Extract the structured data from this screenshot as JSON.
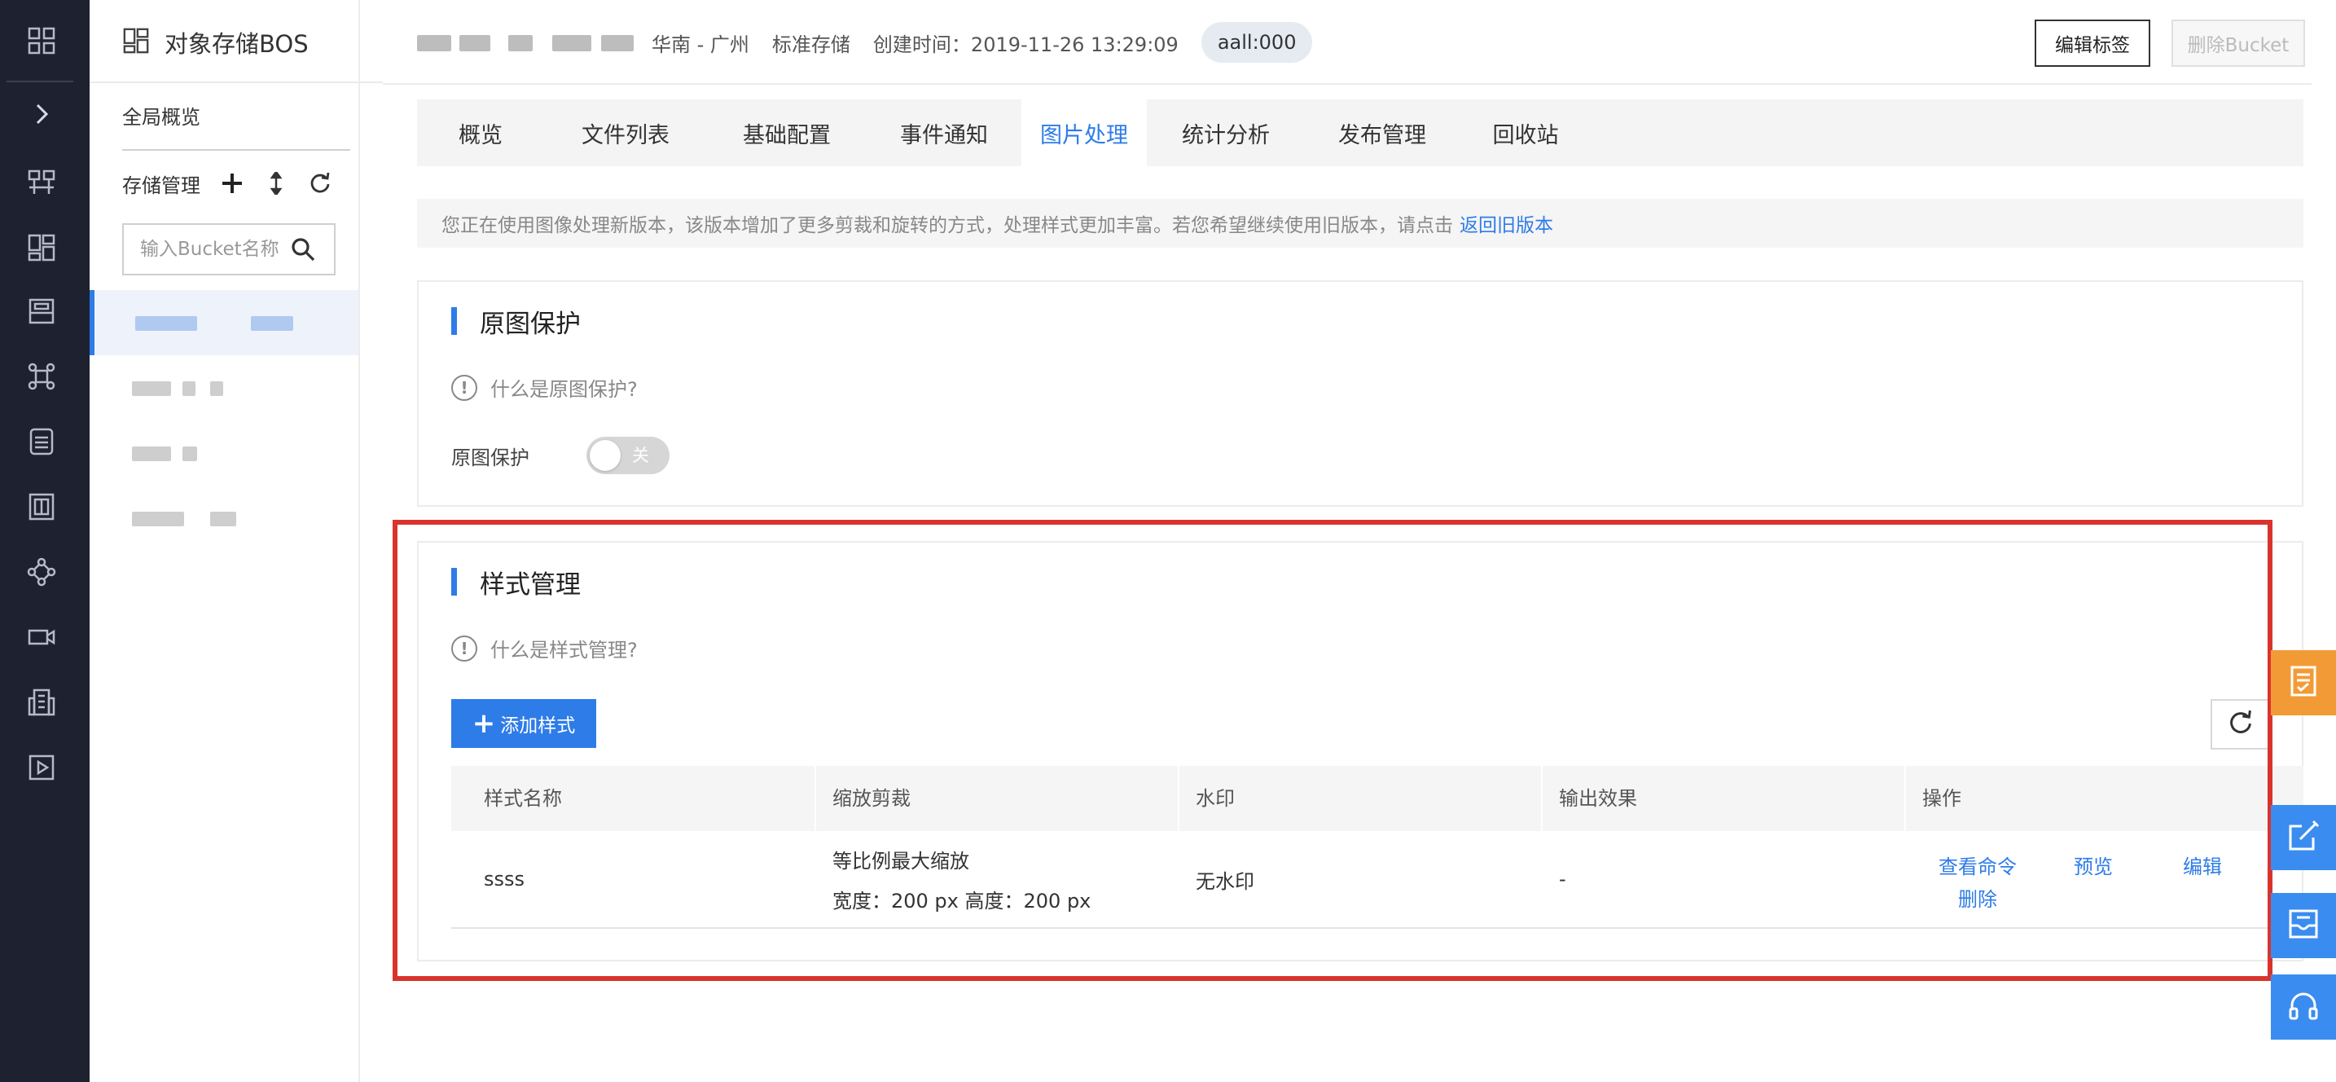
{
  "rail": {
    "icons": [
      "grid-icon",
      "chevron-right-icon",
      "network-icon",
      "dashboard-icon",
      "storage-icon",
      "link-icon",
      "database-icon",
      "building-icon",
      "cluster-icon",
      "camera-icon",
      "office-icon",
      "play-icon"
    ]
  },
  "sidebar": {
    "title": "对象存储BOS",
    "overview": "全局概览",
    "storage_label": "存储管理",
    "search_placeholder": "输入Bucket名称"
  },
  "header": {
    "region": "华南 - 广州",
    "storage_class": "标准存储",
    "created": "创建时间：2019-11-26 13:29:09",
    "tag": "aall:000",
    "edit_tag_button": "编辑标签",
    "delete_bucket_button": "删除Bucket"
  },
  "tabs": [
    {
      "label": "概览"
    },
    {
      "label": "文件列表"
    },
    {
      "label": "基础配置"
    },
    {
      "label": "事件通知"
    },
    {
      "label": "图片处理",
      "active": true
    },
    {
      "label": "统计分析"
    },
    {
      "label": "发布管理"
    },
    {
      "label": "回收站"
    }
  ],
  "notice": {
    "text": "您正在使用图像处理新版本，该版本增加了更多剪裁和旋转的方式，处理样式更加丰富。若您希望继续使用旧版本，请点击",
    "link": "返回旧版本"
  },
  "protect": {
    "title": "原图保护",
    "help": "什么是原图保护?",
    "label": "原图保护",
    "toggle_state": "关"
  },
  "styles": {
    "title": "样式管理",
    "help": "什么是样式管理?",
    "add_button": "添加样式",
    "columns": [
      "样式名称",
      "缩放剪裁",
      "水印",
      "输出效果",
      "操作"
    ],
    "rows": [
      {
        "name": "ssss",
        "scale_mode": "等比例最大缩放",
        "scale_size": "宽度：200 px 高度：200 px",
        "watermark": "无水印",
        "output": "-",
        "ops": {
          "view": "查看命令",
          "preview": "预览",
          "edit": "编辑",
          "delete": "删除"
        }
      }
    ]
  },
  "highlight_color": "#d9342c",
  "accent_color": "#2e7ce8",
  "float_buttons": [
    {
      "icon": "checklist-icon",
      "color": "#f29b36"
    },
    {
      "icon": "edit-icon",
      "color": "#3b8cf0"
    },
    {
      "icon": "inbox-icon",
      "color": "#3b8cf0"
    },
    {
      "icon": "headset-icon",
      "color": "#3b8cf0"
    }
  ]
}
